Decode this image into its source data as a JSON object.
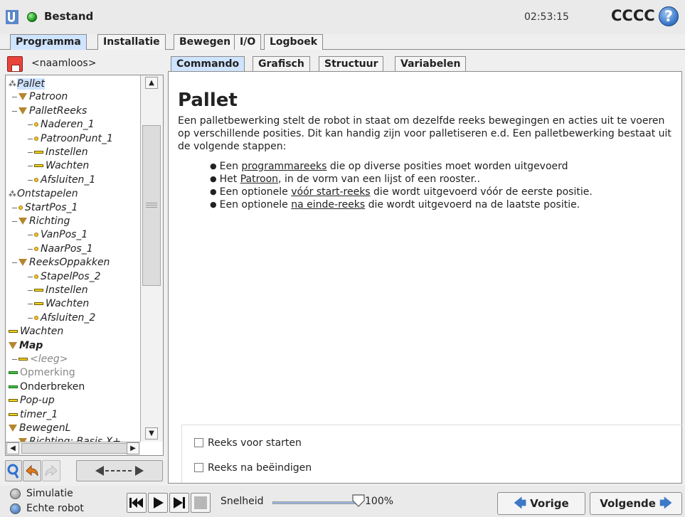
{
  "titlebar": {
    "app_title": "Bestand",
    "clock": "02:53:15",
    "robot_name": "CCCC",
    "help_symbol": "?"
  },
  "main_tabs": [
    {
      "label": "Programma",
      "active": true
    },
    {
      "label": "Installatie",
      "active": false
    },
    {
      "label": "Bewegen",
      "active": false
    },
    {
      "label": "I/O",
      "active": false
    },
    {
      "label": "Logboek",
      "active": false
    }
  ],
  "program": {
    "file_name": "<naamloos>"
  },
  "tree": [
    {
      "label": "Pallet",
      "icon": "pallet-icon",
      "depth": 0,
      "selected": true
    },
    {
      "label": "Patroon",
      "icon": "triangle-icon",
      "depth": 1
    },
    {
      "label": "PalletReeks",
      "icon": "triangle-icon",
      "depth": 1
    },
    {
      "label": "Naderen_1",
      "icon": "waypoint-icon",
      "depth": 2
    },
    {
      "label": "PatroonPunt_1",
      "icon": "waypoint-icon",
      "depth": 2
    },
    {
      "label": "Instellen",
      "icon": "command-icon",
      "depth": 2
    },
    {
      "label": "Wachten",
      "icon": "command-icon",
      "depth": 2
    },
    {
      "label": "Afsluiten_1",
      "icon": "waypoint-icon",
      "depth": 2
    },
    {
      "label": "Ontstapelen",
      "icon": "pallet-icon",
      "depth": 0
    },
    {
      "label": "StartPos_1",
      "icon": "waypoint-icon",
      "depth": 1
    },
    {
      "label": "Richting",
      "icon": "triangle-icon",
      "depth": 1
    },
    {
      "label": "VanPos_1",
      "icon": "waypoint-icon",
      "depth": 2
    },
    {
      "label": "NaarPos_1",
      "icon": "waypoint-icon",
      "depth": 2
    },
    {
      "label": "ReeksOppakken",
      "icon": "triangle-icon",
      "depth": 1
    },
    {
      "label": "StapelPos_2",
      "icon": "waypoint-icon",
      "depth": 2
    },
    {
      "label": "Instellen",
      "icon": "command-icon",
      "depth": 2
    },
    {
      "label": "Wachten",
      "icon": "command-icon",
      "depth": 2
    },
    {
      "label": "Afsluiten_2",
      "icon": "waypoint-icon",
      "depth": 2
    },
    {
      "label": "Wachten",
      "icon": "command-icon",
      "depth": 0
    },
    {
      "label": "Map",
      "icon": "triangle-icon",
      "depth": 0,
      "bold": true
    },
    {
      "label": "<leeg>",
      "icon": "command-icon",
      "depth": 1,
      "grey": true
    },
    {
      "label": "Opmerking",
      "icon": "comment-icon",
      "depth": 0,
      "grey": true,
      "normal": true
    },
    {
      "label": "Onderbreken",
      "icon": "comment-icon",
      "depth": 0,
      "normal": true
    },
    {
      "label": "Pop-up",
      "icon": "command-icon",
      "depth": 0
    },
    {
      "label": "timer_1",
      "icon": "command-icon",
      "depth": 0
    },
    {
      "label": "BewegenL",
      "icon": "triangle-icon",
      "depth": 0
    },
    {
      "label": "Richting: Basis X+",
      "icon": "triangle-icon",
      "depth": 1
    }
  ],
  "content_tabs": [
    {
      "label": "Commando",
      "active": true
    },
    {
      "label": "Grafisch",
      "active": false
    },
    {
      "label": "Structuur",
      "active": false
    },
    {
      "label": "Variabelen",
      "active": false
    }
  ],
  "content": {
    "title": "Pallet",
    "description": "Een palletbewerking stelt de robot in staat om dezelfde reeks bewegingen en acties uit te voeren op verschillende posities. Dit kan handig zijn voor palletiseren e.d. Een palletbewerking bestaat uit de volgende stappen:",
    "bullets": [
      {
        "pre": "Een ",
        "link": "programmareeks",
        "post": " die op diverse posities moet worden uitgevoerd"
      },
      {
        "pre": "Het ",
        "link": "Patroon",
        "post": ", in de vorm van een lijst of een rooster.."
      },
      {
        "pre": "Een optionele ",
        "link": "vóór start-reeks",
        "post": " die wordt uitgevoerd vóór de eerste positie."
      },
      {
        "pre": "Een optionele ",
        "link": "na einde-reeks",
        "post": " die wordt uitgevoerd na de laatste positie."
      }
    ],
    "options": [
      {
        "label": "Reeks voor starten",
        "checked": false
      },
      {
        "label": "Reeks na beëindigen",
        "checked": false
      }
    ]
  },
  "footer": {
    "mode_sim": "Simulatie",
    "mode_real": "Echte robot",
    "speed_label": "Snelheid",
    "speed_value": "100%",
    "speed_fraction": 1.0,
    "prev_label": "Vorige",
    "next_label": "Volgende"
  },
  "colors": {
    "accent_tab": "#cfe4ff",
    "status_green": "#1f9d1f",
    "help_blue": "#3a78c9"
  }
}
